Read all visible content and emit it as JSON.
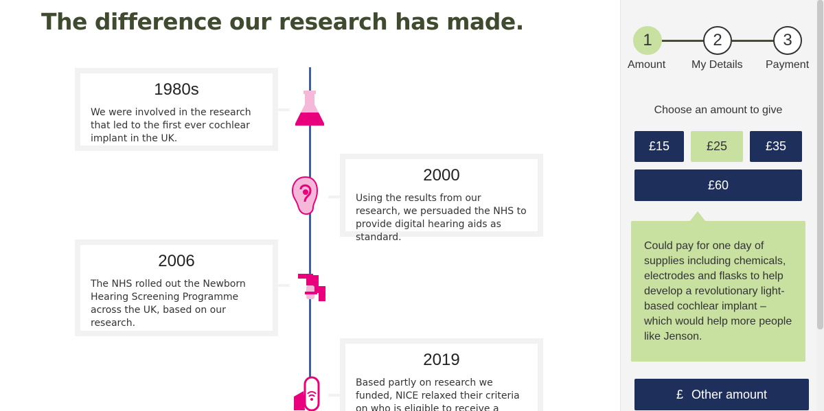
{
  "page": {
    "title": "The difference our research has made."
  },
  "timeline": [
    {
      "year": "1980s",
      "text": "We were involved in the research that led to the first ever cochlear implant in the UK.",
      "icon": "flask-icon"
    },
    {
      "year": "2000",
      "text": "Using the results from our research, we persuaded the NHS to provide digital hearing aids as standard.",
      "icon": "ear-icon"
    },
    {
      "year": "2006",
      "text": "The NHS rolled out the Newborn Hearing Screening Programme across the UK, based on our research.",
      "icon": "otoscope-icon"
    },
    {
      "year": "2019",
      "text": "Based partly on research we funded, NICE relaxed their criteria on who is eligible to receive a",
      "icon": "cochlear-implant-icon"
    }
  ],
  "donation": {
    "steps": [
      {
        "number": "1",
        "label": "Amount",
        "state": "active"
      },
      {
        "number": "2",
        "label": "My Details",
        "state": "inactive"
      },
      {
        "number": "3",
        "label": "Payment",
        "state": "inactive"
      }
    ],
    "choose_label": "Choose an amount to give",
    "amounts": [
      {
        "label": "£15",
        "selected": false
      },
      {
        "label": "£25",
        "selected": true
      },
      {
        "label": "£35",
        "selected": false
      },
      {
        "label": "£60",
        "selected": false
      }
    ],
    "info_text": "Could pay for one day of supplies including chemicals, electrodes and flasks to help develop a revolutionary light-based cochlear implant – which would help more people like Jenson.",
    "other_amount": {
      "symbol": "£",
      "label": "Other amount"
    }
  },
  "colors": {
    "title": "#3f4a2e",
    "timeline_line": "#3f5fa0",
    "accent_pink": "#e8007c",
    "light_pink": "#f5b8d8",
    "navy": "#1f2f5c",
    "green": "#c8e0a0"
  }
}
